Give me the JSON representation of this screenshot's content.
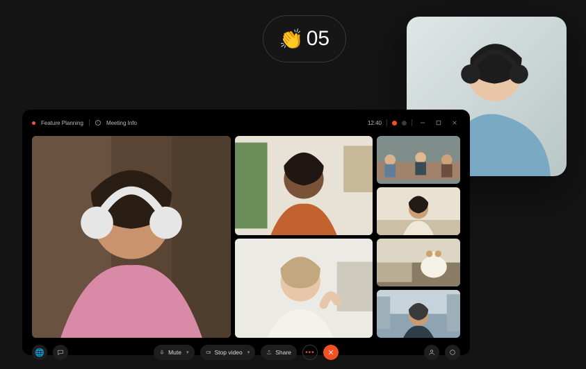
{
  "reaction": {
    "emoji": "👏",
    "count": "05"
  },
  "meeting": {
    "title": "Feature Planning",
    "info_label": "Meeting Info",
    "clock": "12:40"
  },
  "controls": {
    "mute": "Mute",
    "stop_video": "Stop video",
    "share": "Share"
  },
  "icons": {
    "globe": "🌐"
  }
}
